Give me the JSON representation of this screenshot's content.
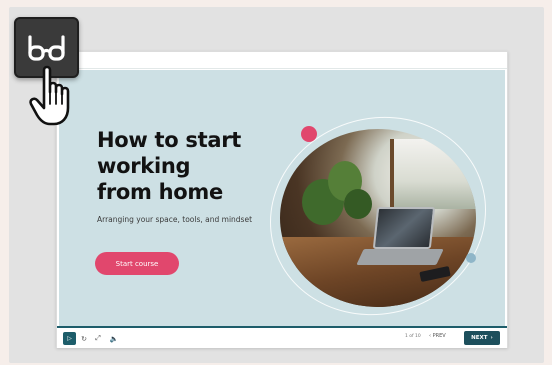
{
  "slide": {
    "title_lines": [
      "How to start",
      "working",
      "from home"
    ],
    "subtitle": "Arranging your space, tools, and mindset",
    "cta_label": "Start course"
  },
  "player": {
    "progress": 1.0,
    "page_indicator": "1 of 10",
    "prev_label": "PREV",
    "next_label": "NEXT",
    "play_icon": "▷",
    "replay_icon": "↻",
    "fullscreen_icon": "⤢",
    "volume_icon": "🔈",
    "prev_icon": "‹",
    "next_icon": "›"
  },
  "overlay": {
    "badge_icon": "glasses-icon",
    "cursor_icon": "hand-pointer-icon"
  },
  "colors": {
    "accent_pink": "#e1476d",
    "accent_teal": "#1d5d6a",
    "slide_bg": "#cde0e4"
  }
}
